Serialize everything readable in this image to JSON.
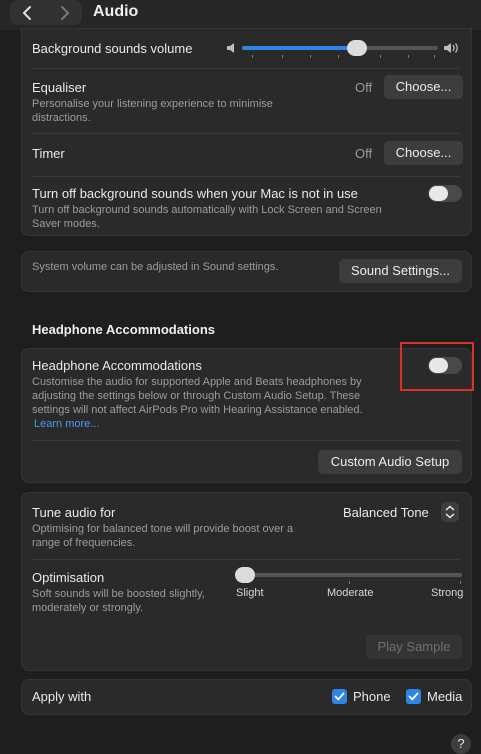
{
  "header": {
    "title": "Audio"
  },
  "background": {
    "volume_label": "Background sounds volume",
    "volume_level": 0.57,
    "equaliser": {
      "label": "Equaliser",
      "sub": "Personalise your listening experience to minimise distractions.",
      "value": "Off",
      "button": "Choose..."
    },
    "timer": {
      "label": "Timer",
      "value": "Off",
      "button": "Choose..."
    },
    "mac_off": {
      "label": "Turn off background sounds when your Mac is not in use",
      "sub": "Turn off background sounds automatically with Lock Screen and Screen Saver modes.",
      "on": false
    }
  },
  "sound_settings": {
    "text": "System volume can be adjusted in Sound settings.",
    "button": "Sound Settings..."
  },
  "headphone": {
    "section_title": "Headphone Accommodations",
    "label": "Headphone Accommodations",
    "sub": "Customise the audio for supported Apple and Beats headphones by adjusting the settings below or through Custom Audio Setup. These settings will not affect AirPods Pro with Hearing Assistance enabled.",
    "learn_more": "Learn more...",
    "on": false,
    "custom_button": "Custom Audio Setup"
  },
  "tune": {
    "label": "Tune audio for",
    "sub": "Optimising for balanced tone will provide boost over a range of frequencies.",
    "value": "Balanced Tone"
  },
  "optimisation": {
    "label": "Optimisation",
    "sub": "Soft sounds will be boosted slightly, moderately or strongly.",
    "levels": [
      "Slight",
      "Moderate",
      "Strong"
    ],
    "selected": "Slight",
    "play_button": "Play Sample"
  },
  "apply": {
    "label": "Apply with",
    "options": [
      {
        "label": "Phone",
        "checked": true
      },
      {
        "label": "Media",
        "checked": true
      }
    ]
  },
  "help": "?",
  "colors": {
    "accent": "#2f84e8",
    "highlight": "#d9302a"
  }
}
